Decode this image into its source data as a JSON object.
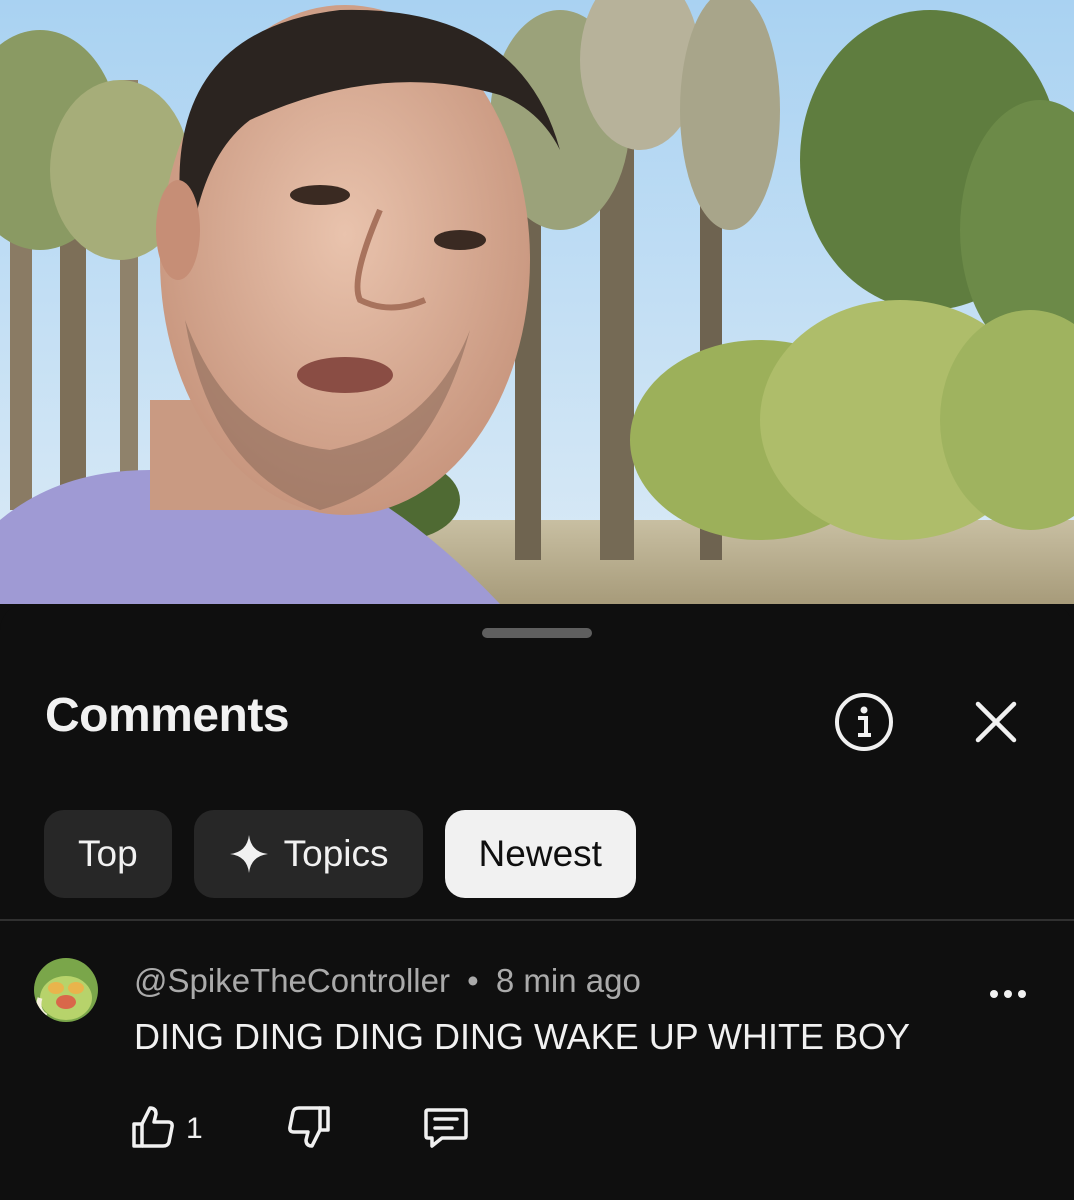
{
  "sheet": {
    "title": "Comments"
  },
  "header_icons": [
    "info-icon",
    "close-icon"
  ],
  "filters": [
    {
      "label": "Top",
      "selected": false
    },
    {
      "label": "Topics",
      "selected": false,
      "icon": "sparkle-icon"
    },
    {
      "label": "Newest",
      "selected": true
    }
  ],
  "comment": {
    "author": "@SpikeTheController",
    "separator": "•",
    "time": "8 min ago",
    "text": "DING DING DING DING WAKE UP WHITE BOY",
    "like_count": "1",
    "icons": [
      "thumbs-up-icon",
      "thumbs-down-icon",
      "reply-icon",
      "more-icon"
    ]
  },
  "colors": {
    "background": "#0f0f0f",
    "chip": "#272727",
    "chip_selected": "#f1f1f1",
    "text_primary": "#f1f1f1",
    "text_secondary": "#aaaaaa"
  }
}
